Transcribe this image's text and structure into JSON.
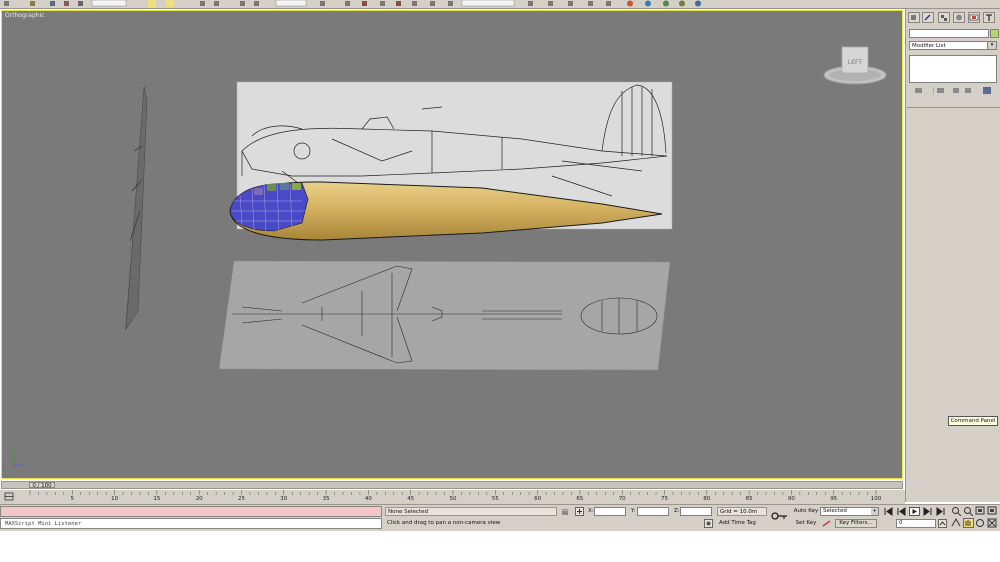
{
  "viewport": {
    "label": "Orthographic",
    "viewcube_face": "LEFT",
    "border_color": "#e6e642",
    "background": "#7a7a7a"
  },
  "command_panel": {
    "tabs": [
      "create-icon",
      "modify-icon",
      "hierarchy-icon",
      "motion-icon",
      "display-icon",
      "utilities-icon"
    ],
    "modifier_list": "Modifier List",
    "tooltip": "Command Panel"
  },
  "timeline": {
    "slider_label": "0 / 100",
    "ticks": [
      "0",
      "5",
      "10",
      "15",
      "20",
      "25",
      "30",
      "35",
      "40",
      "45",
      "50",
      "55",
      "60",
      "65",
      "70",
      "75",
      "80",
      "85",
      "90",
      "95",
      "100"
    ]
  },
  "status": {
    "maxscript_placeholder": "MAXScript Mini Listener",
    "selection": "None Selected",
    "prompt": "Click and drag to pan a non-camera view",
    "x_label": "X:",
    "y_label": "Y:",
    "z_label": "Z:",
    "x_value": "",
    "y_value": "",
    "z_value": "",
    "grid": "Grid = 10.0m",
    "add_time_tag": "Add Time Tag",
    "auto_key": "Auto Key",
    "set_key": "Set Key",
    "selected_dropdown": "Selected",
    "key_filters": "Key Filters...",
    "current_frame": "0"
  }
}
